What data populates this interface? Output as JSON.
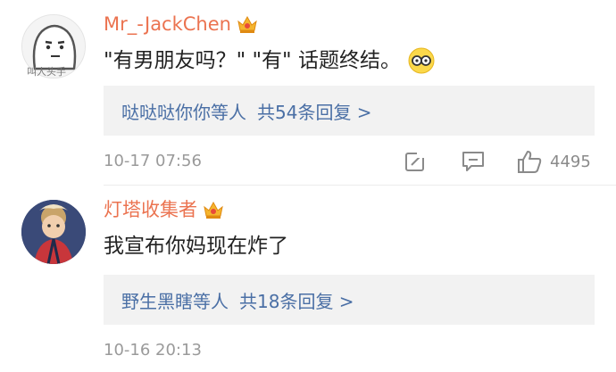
{
  "comments": [
    {
      "username": "Mr_-JackChen",
      "avatar_caption": "叫人头手",
      "text": "\"有男朋友吗？\" \"有\" 话题终结。",
      "replies": {
        "names": "哒哒哒你你",
        "mid": "等人",
        "count": "共54条回复 >"
      },
      "time": "10-17 07:56",
      "likes": "4495"
    },
    {
      "username": "灯塔收集者",
      "text": "我宣布你妈现在炸了",
      "replies": {
        "names": "野生黑瞎",
        "mid": "等人",
        "count": "共18条回复 >"
      },
      "time": "10-16 20:13"
    }
  ],
  "icons": {
    "crown": "vip-crown-icon",
    "emoji": "glasses-emoji-icon",
    "forward": "forward-icon",
    "comment": "comment-icon",
    "like": "thumbs-up-icon"
  },
  "colors": {
    "username": "#eb7350",
    "link": "#4a6fa5",
    "meta": "#9a9a9a",
    "reply_bg": "#f2f2f2"
  }
}
